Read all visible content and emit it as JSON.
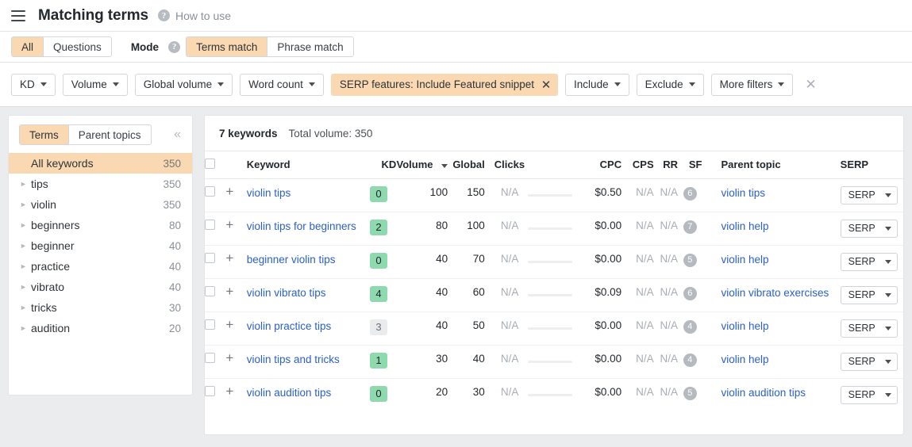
{
  "header": {
    "menu_icon": "hamburger-icon",
    "title": "Matching terms",
    "help_icon": "question-mark-icon",
    "how_to_use": "How to use"
  },
  "mode_bar": {
    "scope_tabs": [
      {
        "label": "All",
        "active": true
      },
      {
        "label": "Questions",
        "active": false
      }
    ],
    "mode_label": "Mode",
    "mode_help_icon": "question-mark-icon",
    "mode_tabs": [
      {
        "label": "Terms match",
        "active": true
      },
      {
        "label": "Phrase match",
        "active": false
      }
    ]
  },
  "filters": {
    "buttons": [
      "KD",
      "Volume",
      "Global volume",
      "Word count"
    ],
    "active_chip": "SERP features: Include Featured snippet",
    "chip_remove_icon": "close-icon",
    "right_buttons": [
      "Include",
      "Exclude",
      "More filters"
    ],
    "clear_all_icon": "close-icon"
  },
  "sidebar": {
    "tabs": [
      {
        "label": "Terms",
        "active": true
      },
      {
        "label": "Parent topics",
        "active": false
      }
    ],
    "collapse_icon": "chevron-double-left-icon",
    "items": [
      {
        "label": "All keywords",
        "count": "350",
        "selected": true,
        "expandable": false
      },
      {
        "label": "tips",
        "count": "350",
        "selected": false,
        "expandable": true
      },
      {
        "label": "violin",
        "count": "350",
        "selected": false,
        "expandable": true
      },
      {
        "label": "beginners",
        "count": "80",
        "selected": false,
        "expandable": true
      },
      {
        "label": "beginner",
        "count": "40",
        "selected": false,
        "expandable": true
      },
      {
        "label": "practice",
        "count": "40",
        "selected": false,
        "expandable": true
      },
      {
        "label": "vibrato",
        "count": "40",
        "selected": false,
        "expandable": true
      },
      {
        "label": "tricks",
        "count": "30",
        "selected": false,
        "expandable": true
      },
      {
        "label": "audition",
        "count": "20",
        "selected": false,
        "expandable": true
      }
    ]
  },
  "table": {
    "keyword_count": "7 keywords",
    "total_volume": "Total volume: 350",
    "select_all_checkbox": "unchecked",
    "columns": {
      "keyword": "Keyword",
      "kd": "KD",
      "volume": "Volume",
      "global": "Global",
      "clicks": "Clicks",
      "cpc": "CPC",
      "cps": "CPS",
      "rr": "RR",
      "sf": "SF",
      "parent_topic": "Parent topic",
      "serp": "SERP"
    },
    "sorted_column": "Volume",
    "sort_direction": "desc",
    "serp_button_label": "SERP",
    "rows": [
      {
        "keyword": "violin tips",
        "kd": "0",
        "kd_color": "green",
        "volume": "100",
        "global": "150",
        "clicks": "N/A",
        "cpc": "$0.50",
        "cps": "N/A",
        "rr": "N/A",
        "sf": "6",
        "parent_topic": "violin tips"
      },
      {
        "keyword": "violin tips for beginners",
        "kd": "2",
        "kd_color": "green",
        "volume": "80",
        "global": "100",
        "clicks": "N/A",
        "cpc": "$0.00",
        "cps": "N/A",
        "rr": "N/A",
        "sf": "7",
        "parent_topic": "violin help"
      },
      {
        "keyword": "beginner violin tips",
        "kd": "0",
        "kd_color": "green",
        "volume": "40",
        "global": "70",
        "clicks": "N/A",
        "cpc": "$0.00",
        "cps": "N/A",
        "rr": "N/A",
        "sf": "5",
        "parent_topic": "violin help"
      },
      {
        "keyword": "violin vibrato tips",
        "kd": "4",
        "kd_color": "green",
        "volume": "40",
        "global": "60",
        "clicks": "N/A",
        "cpc": "$0.09",
        "cps": "N/A",
        "rr": "N/A",
        "sf": "6",
        "parent_topic": "violin vibrato exercises"
      },
      {
        "keyword": "violin practice tips",
        "kd": "3",
        "kd_color": "grey",
        "volume": "40",
        "global": "50",
        "clicks": "N/A",
        "cpc": "$0.00",
        "cps": "N/A",
        "rr": "N/A",
        "sf": "4",
        "parent_topic": "violin help"
      },
      {
        "keyword": "violin tips and tricks",
        "kd": "1",
        "kd_color": "green",
        "volume": "30",
        "global": "40",
        "clicks": "N/A",
        "cpc": "$0.00",
        "cps": "N/A",
        "rr": "N/A",
        "sf": "4",
        "parent_topic": "violin help"
      },
      {
        "keyword": "violin audition tips",
        "kd": "0",
        "kd_color": "green",
        "volume": "20",
        "global": "30",
        "clicks": "N/A",
        "cpc": "$0.00",
        "cps": "N/A",
        "rr": "N/A",
        "sf": "5",
        "parent_topic": "violin audition tips"
      }
    ]
  },
  "colors": {
    "accent": "#fad9b2",
    "link": "#2b60c6",
    "kd_green": "#8ed9ad",
    "kd_grey": "#e9ebec",
    "page_bg": "#ebecee"
  }
}
